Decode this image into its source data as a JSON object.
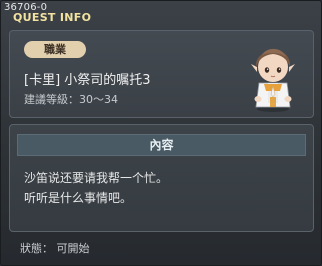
{
  "window": {
    "quest_id": "36706-0",
    "title": "QUEST INFO"
  },
  "quest": {
    "job_badge": "職業",
    "name": "[卡里] 小祭司的嘱托3",
    "level_label": "建議等級：30～34"
  },
  "npc": {
    "icon": "npc-portrait-icon",
    "colors": {
      "hair": "#7a5a44",
      "skin": "#f2d7c2",
      "outfit": "#f7f7f7",
      "accent": "#e39b2c"
    }
  },
  "content": {
    "header": "內容",
    "lines": [
      "沙笛说还要请我帮一个忙。",
      "听听是什么事情吧。"
    ]
  },
  "footer": {
    "status": "狀態： 可開始"
  }
}
